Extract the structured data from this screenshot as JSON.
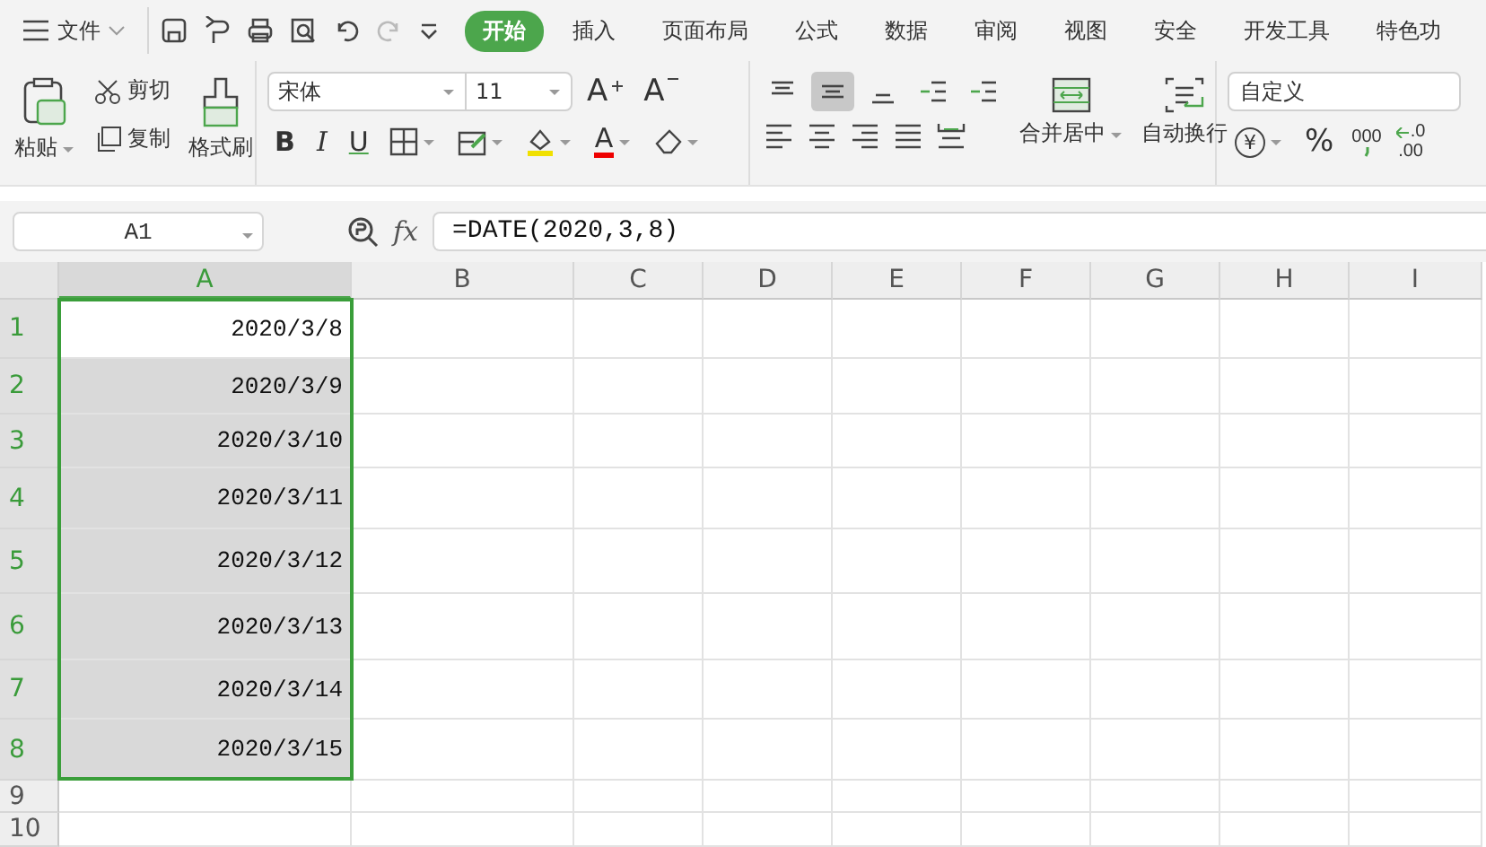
{
  "menu": {
    "file": "文件",
    "tabs": [
      {
        "label": "开始",
        "selected": true
      },
      {
        "label": "插入",
        "selected": false
      },
      {
        "label": "页面布局",
        "selected": false
      },
      {
        "label": "公式",
        "selected": false
      },
      {
        "label": "数据",
        "selected": false
      },
      {
        "label": "审阅",
        "selected": false
      },
      {
        "label": "视图",
        "selected": false
      },
      {
        "label": "安全",
        "selected": false
      },
      {
        "label": "开发工具",
        "selected": false
      },
      {
        "label": "特色功",
        "selected": false
      }
    ]
  },
  "ribbon": {
    "paste": "粘贴",
    "cut": "剪切",
    "copy": "复制",
    "format_painter": "格式刷",
    "font_name": "宋体",
    "font_size": "11",
    "grow_font": "A",
    "shrink_font": "A",
    "bold": "B",
    "italic": "I",
    "underline": "U",
    "font_color": "A",
    "align_top": [
      {
        "kind": "top",
        "selected": false
      },
      {
        "kind": "middle",
        "selected": true
      },
      {
        "kind": "bottom",
        "selected": false
      },
      {
        "kind": "outdent",
        "selected": false
      },
      {
        "kind": "indent",
        "selected": false
      }
    ],
    "merge": "合并居中",
    "wrap": "自动换行",
    "number_format": "自定义",
    "currency": "¥",
    "percent": "%",
    "thousands": "000",
    "decimal_increase": {
      "top": ".0",
      "bottom": ".00"
    }
  },
  "formula_bar": {
    "name_box": "A1",
    "fx": "fx",
    "formula": "=DATE(2020,3,8)"
  },
  "sheet": {
    "columns": [
      {
        "label": "A",
        "selected": true
      },
      {
        "label": "B",
        "selected": false
      },
      {
        "label": "C",
        "selected": false
      },
      {
        "label": "D",
        "selected": false
      },
      {
        "label": "E",
        "selected": false
      },
      {
        "label": "F",
        "selected": false
      },
      {
        "label": "G",
        "selected": false
      },
      {
        "label": "H",
        "selected": false
      },
      {
        "label": "I",
        "selected": false
      }
    ],
    "rows": [
      {
        "label": "1",
        "value": "2020/3/8",
        "selected": true,
        "active": true
      },
      {
        "label": "2",
        "value": "2020/3/9",
        "selected": true,
        "active": false
      },
      {
        "label": "3",
        "value": "2020/3/10",
        "selected": true,
        "active": false
      },
      {
        "label": "4",
        "value": "2020/3/11",
        "selected": true,
        "active": false
      },
      {
        "label": "5",
        "value": "2020/3/12",
        "selected": true,
        "active": false
      },
      {
        "label": "6",
        "value": "2020/3/13",
        "selected": true,
        "active": false
      },
      {
        "label": "7",
        "value": "2020/3/14",
        "selected": true,
        "active": false
      },
      {
        "label": "8",
        "value": "2020/3/15",
        "selected": true,
        "active": false
      },
      {
        "label": "9",
        "value": "",
        "selected": false
      },
      {
        "label": "10",
        "value": "",
        "selected": false
      }
    ]
  }
}
